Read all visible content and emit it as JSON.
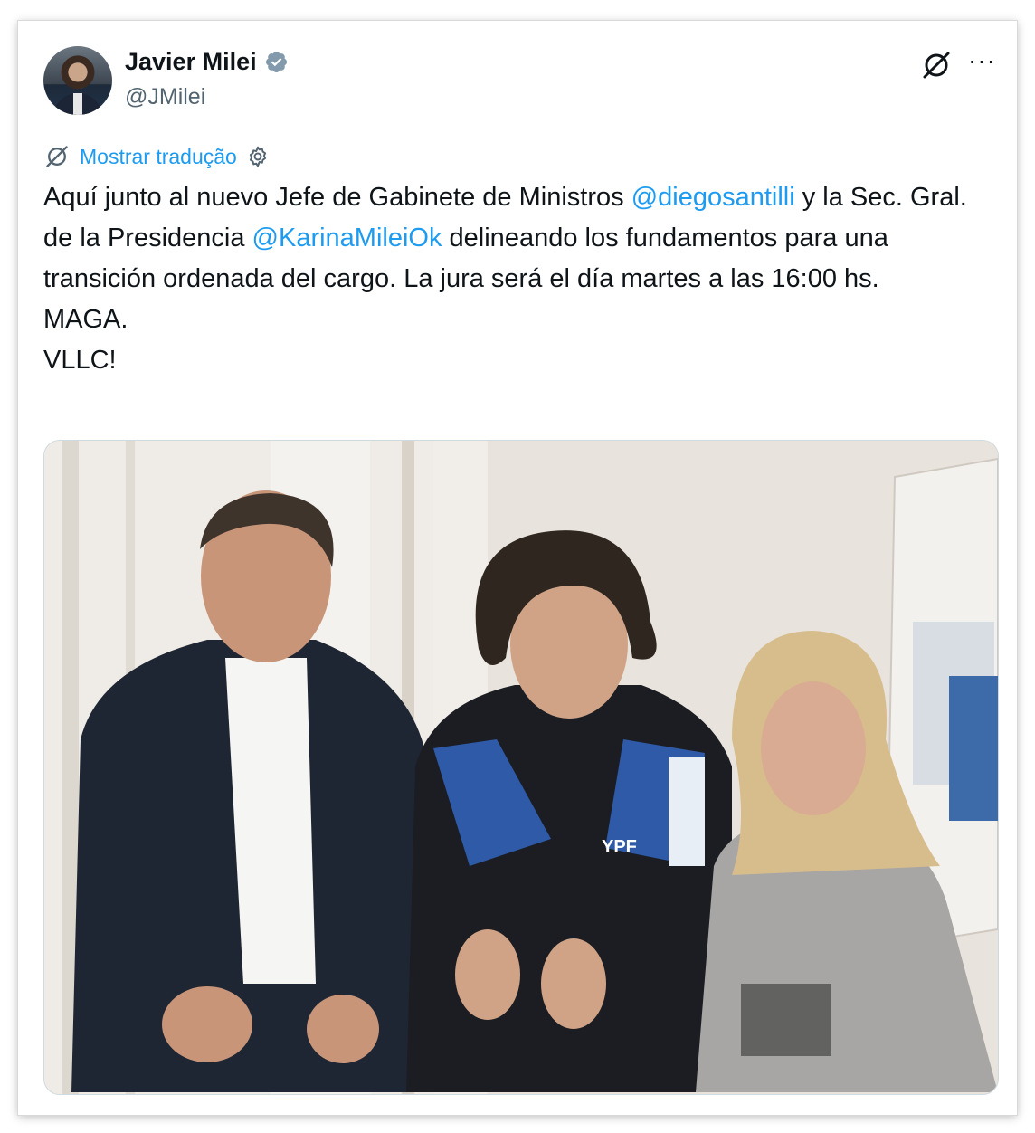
{
  "author": {
    "name": "Javier Milei",
    "handle": "@JMilei",
    "verified": true,
    "avatar_icon": "avatar-photo"
  },
  "actions": {
    "grok_icon": "grok-icon",
    "more_label": "···"
  },
  "translate": {
    "label": "Mostrar tradução",
    "icon": "grok-icon",
    "settings_icon": "gear-icon"
  },
  "tweet": {
    "part1": "Aquí junto al nuevo Jefe de Gabinete de Ministros ",
    "mention1": "@diegosantilli",
    "part2": " y la Sec. Gral. de la Presidencia ",
    "mention2": "@KarinaMileiOk",
    "part3": " delineando los fundamentos para una transición ordenada del cargo. La jura será el día martes a las 16:00 hs.\nMAGA.\nVLLC!"
  },
  "media": {
    "jacket_logo": "YPF"
  },
  "colors": {
    "accent": "#1d9bf0",
    "text": "#0f1419",
    "secondary": "#536471"
  }
}
